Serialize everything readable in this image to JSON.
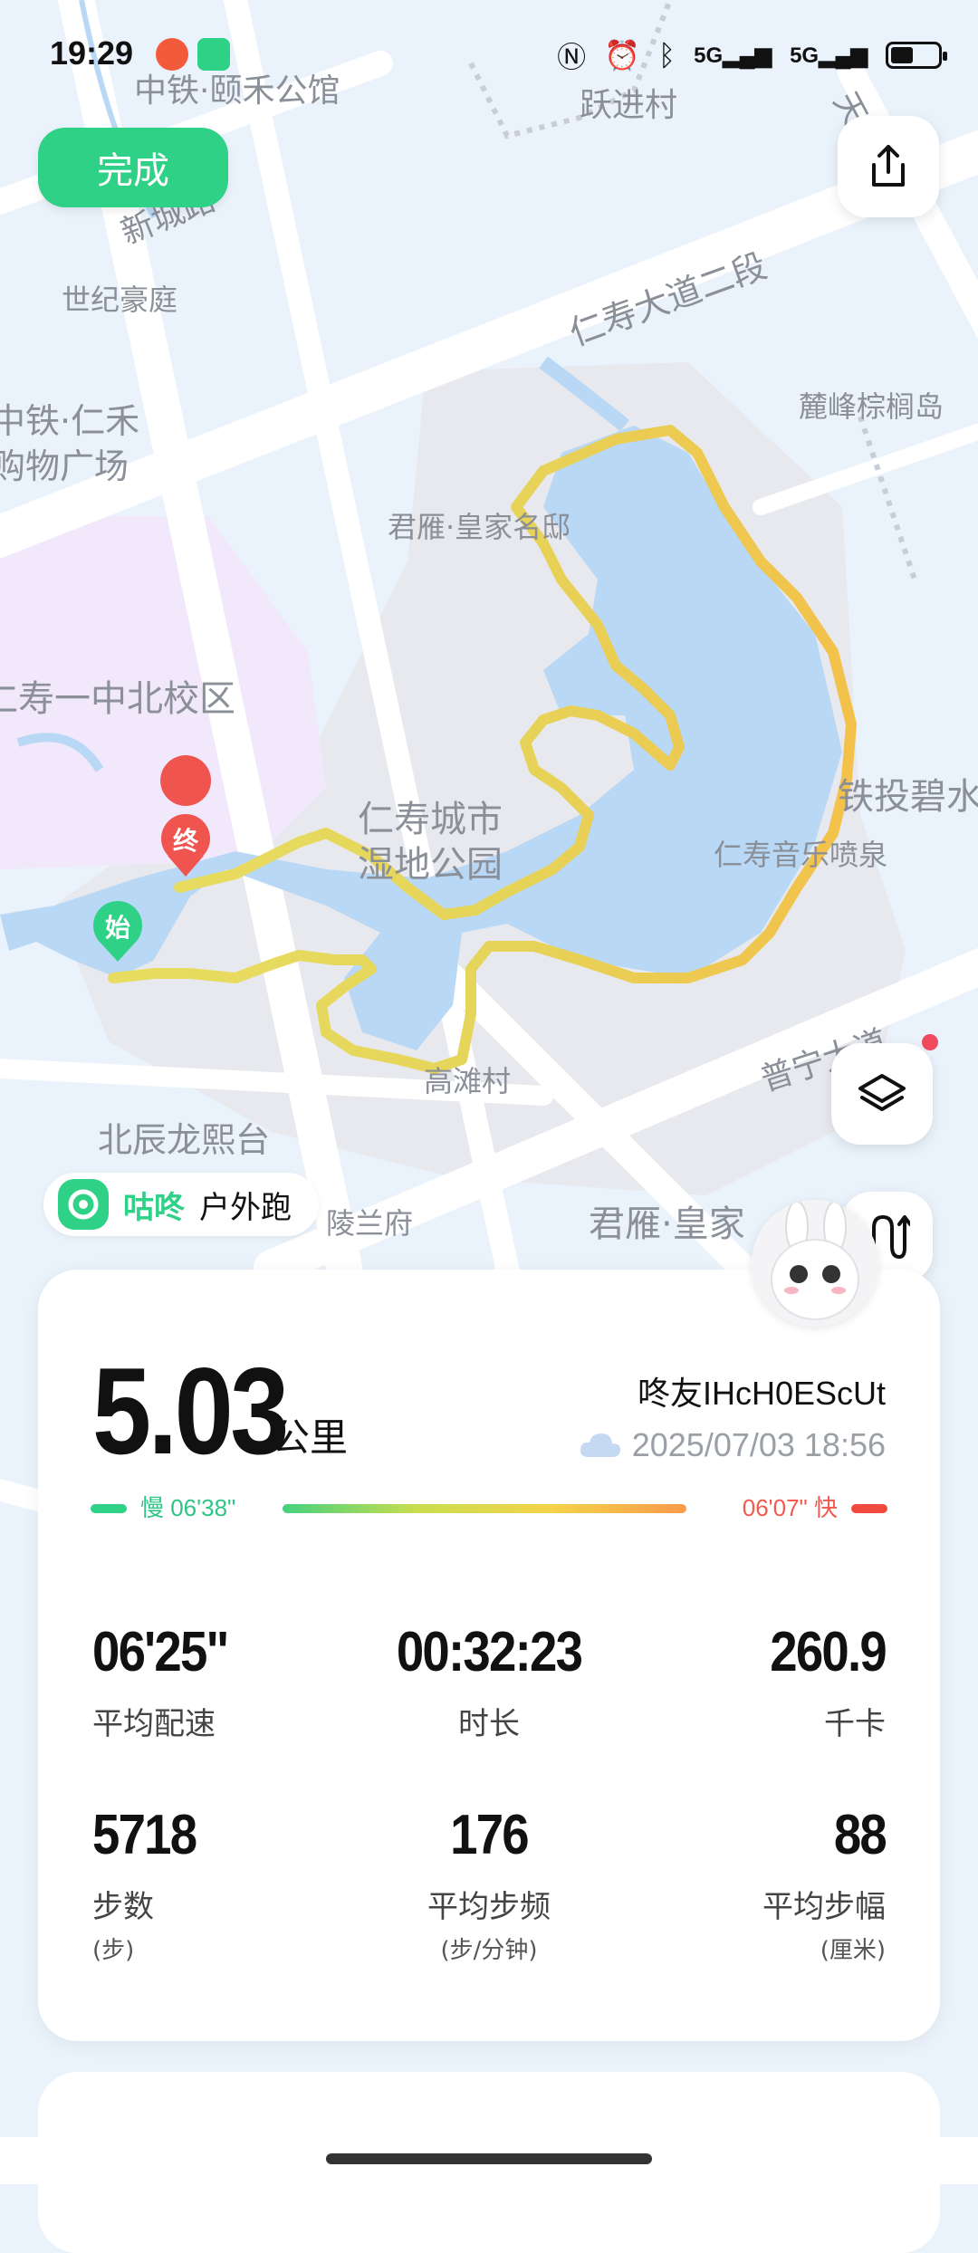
{
  "status_bar": {
    "time": "19:29",
    "network1": "5G",
    "network2": "5G",
    "icons": [
      "weibo-icon",
      "gudong-app-icon",
      "nfc-icon",
      "alarm-icon",
      "bluetooth-icon",
      "signal-icon",
      "battery-icon"
    ]
  },
  "header": {
    "done_label": "完成",
    "share_icon": "share-icon",
    "layers_icon": "layers-icon",
    "route_icon": "route-icon"
  },
  "map": {
    "labels": [
      "中铁·颐禾公馆",
      "跃进村",
      "新城路",
      "世纪豪庭",
      "仁寿大道二段",
      "麓峰棕榈岛",
      "天府大道",
      "中铁·仁禾",
      "购物广场",
      "君雁·皇家名邸",
      "仁寿一中北校区",
      "仁寿城市",
      "湿地公园",
      "铁投碧水",
      "仁寿音乐喷泉",
      "普宁大道",
      "高滩村",
      "北辰龙熙台",
      "陵兰府",
      "君雁·皇家"
    ],
    "start_label": "始",
    "end_label": "终",
    "route_colors": {
      "slow": "#d9dd63",
      "fast": "#f4c64a"
    }
  },
  "activity_tag": {
    "brand": "咕咚",
    "type": "户外跑"
  },
  "summary": {
    "distance": "5.03",
    "distance_unit": "公里",
    "username": "咚友IHcH0EScUt",
    "datetime": "2025/07/03 18:56",
    "weather_icon": "cloud-icon",
    "pace_slow_label": "慢 06'38\"",
    "pace_fast_label": "06'07\" 快"
  },
  "stats": [
    {
      "value": "06'25\"",
      "label": "平均配速",
      "unit": ""
    },
    {
      "value": "00:32:23",
      "label": "时长",
      "unit": ""
    },
    {
      "value": "260.9",
      "label": "千卡",
      "unit": ""
    },
    {
      "value": "5718",
      "label": "步数",
      "unit": "(步)"
    },
    {
      "value": "176",
      "label": "平均步频",
      "unit": "(步/分钟)"
    },
    {
      "value": "88",
      "label": "平均步幅",
      "unit": "(厘米)"
    }
  ],
  "colors": {
    "accent": "#2fd186",
    "fast": "#f04a3f",
    "water": "#b9d8f5",
    "park": "#e6e8ec",
    "school": "#f1e8fb"
  }
}
